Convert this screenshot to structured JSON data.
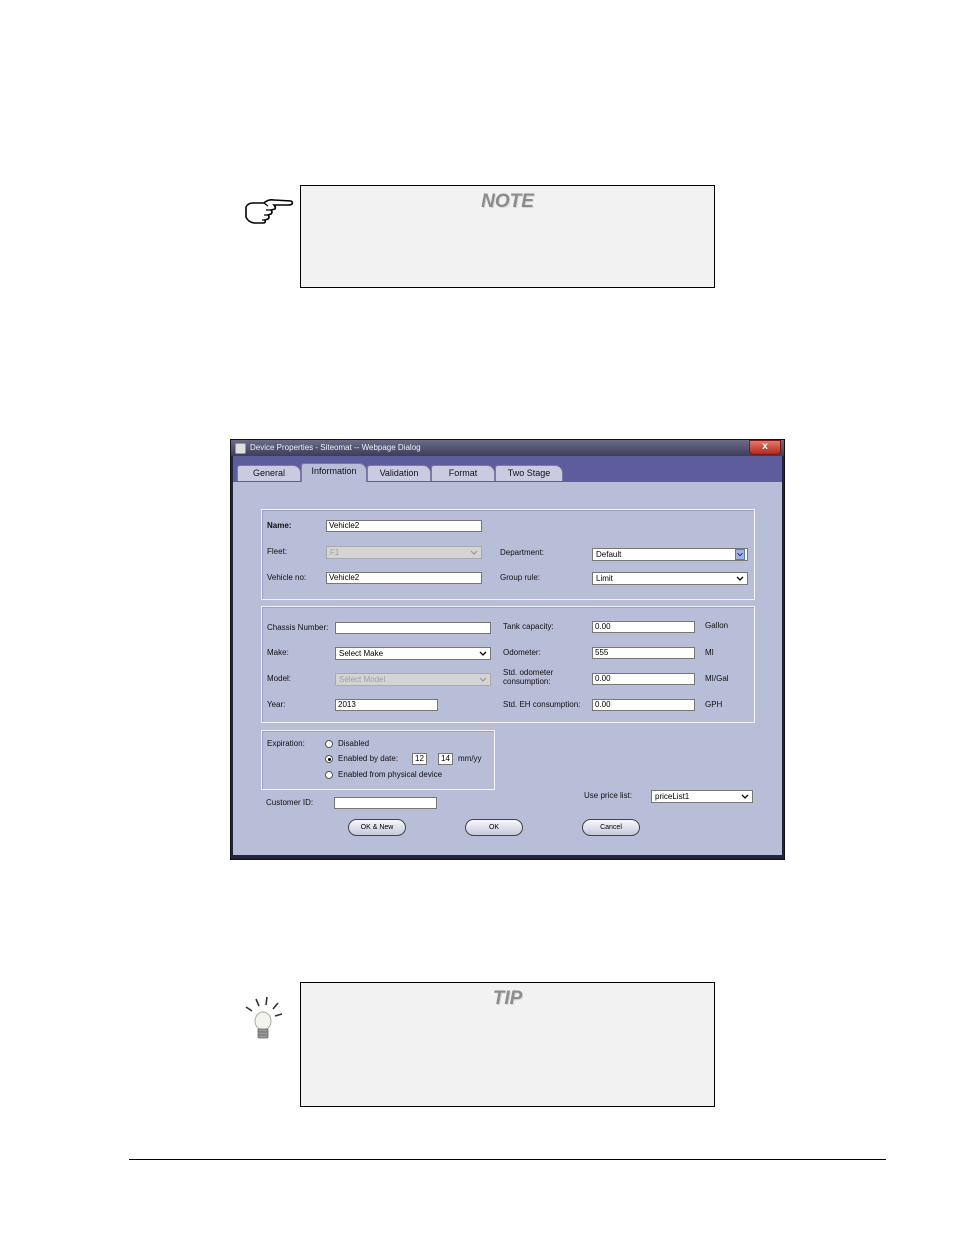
{
  "note": {
    "title": "NOTE"
  },
  "tip": {
    "title": "TIP"
  },
  "dialog": {
    "title": "Device Properties - Siteomat -- Webpage Dialog",
    "close_glyph": "x",
    "tabs": [
      "General",
      "Information",
      "Validation",
      "Format",
      "Two Stage"
    ],
    "active_tab": "Information",
    "name_label": "Name:",
    "name_value": "Vehicle2",
    "fleet_label": "Fleet:",
    "fleet_value": "F1",
    "department_label": "Department:",
    "department_value": "Default",
    "vehicle_no_label": "Vehicle no:",
    "vehicle_no_value": "Vehicle2",
    "group_rule_label": "Group rule:",
    "group_rule_value": "Limit",
    "chassis_label": "Chassis Number:",
    "chassis_value": "",
    "make_label": "Make:",
    "make_value": "Select Make",
    "model_label": "Model:",
    "model_value": "Select Model",
    "year_label": "Year:",
    "year_value": "2013",
    "tank_label": "Tank capacity:",
    "tank_value": "0.00",
    "tank_unit": "Gallon",
    "odometer_label": "Odometer:",
    "odometer_value": "555",
    "odometer_unit": "MI",
    "std_odo_label_1": "Std. odometer",
    "std_odo_label_2": "consumption:",
    "std_odo_value": "0.00",
    "std_odo_unit": "MI/Gal",
    "std_eh_label": "Std. EH consumption:",
    "std_eh_value": "0.00",
    "std_eh_unit": "GPH",
    "expiration_label": "Expiration:",
    "exp_options": [
      "Disabled",
      "Enabled by date:",
      "Enabled from physical device"
    ],
    "exp_selected": "Enabled by date:",
    "exp_month": "12",
    "exp_year": "14",
    "exp_format": "mm/yy",
    "customer_id_label": "Customer ID:",
    "customer_id_value": "",
    "price_list_label": "Use price list:",
    "price_list_value": "priceList1",
    "ok_new_label": "OK & New",
    "ok_label": "OK",
    "cancel_label": "Cancel"
  }
}
